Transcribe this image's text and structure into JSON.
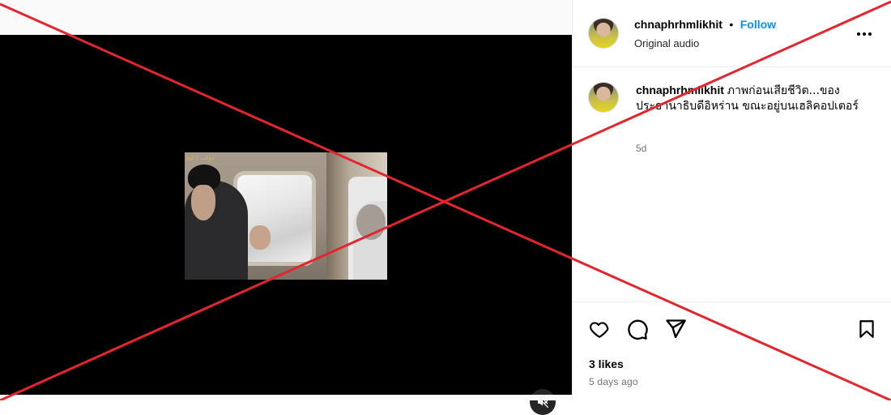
{
  "post": {
    "username": "chnaphrhmlikhit",
    "separator": "•",
    "follow_label": "Follow",
    "audio_label": "Original audio",
    "more_label": "•••"
  },
  "video": {
    "watermark": "دولت | لبد"
  },
  "caption": {
    "username": "chnaphrhmlikhit",
    "text": "ภาพก่อนเสียชีวิต...ของประธานาธิบดีอิหร่าน ขณะอยู่บนเฮลิคอปเตอร์",
    "age": "5d"
  },
  "engagement": {
    "likes": "3 likes",
    "time_ago": "5 days ago"
  },
  "icons": {
    "like": "heart-icon",
    "comment": "comment-icon",
    "share": "share-icon",
    "save": "bookmark-icon",
    "mute": "muted-speaker-icon",
    "more": "more-options-icon"
  },
  "colors": {
    "follow": "#0095f6",
    "cross_out": "#e4252f",
    "media_bg": "#000000"
  }
}
